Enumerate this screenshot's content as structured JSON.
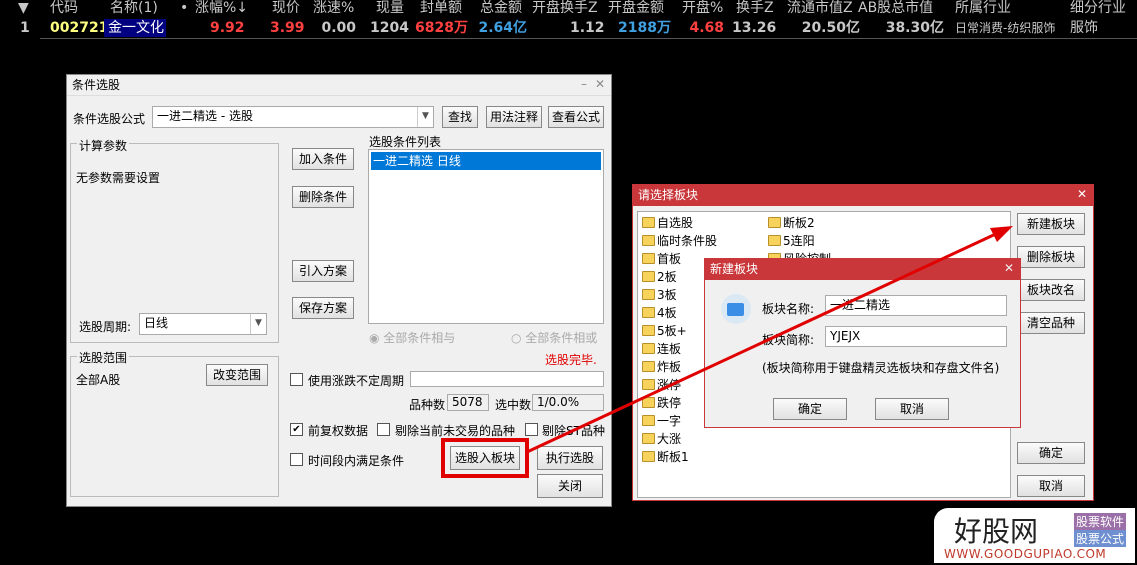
{
  "table": {
    "headers": [
      "▼",
      "代码",
      "名称(1)",
      "•",
      "涨幅%↓",
      "现价",
      "涨速%",
      "现量",
      "封单额",
      "总金额",
      "开盘换手Z",
      "开盘金额",
      "开盘%",
      "换手Z",
      "流通市值Z",
      "AB股总市值",
      "所属行业",
      "细分行业"
    ],
    "row": {
      "index": "1",
      "code": "002721",
      "name": "金一文化",
      "change_pct": "9.92",
      "price": "3.99",
      "speed": "0.00",
      "volume": "1204",
      "seal_amount": "6828万",
      "total_amount": "2.64亿",
      "open_turnover": "1.12",
      "open_amount": "2188万",
      "open_pct": "4.68",
      "turnover": "13.26",
      "float_cap": "20.50亿",
      "total_cap": "38.30亿",
      "industry": "日常消费-纺织服饰",
      "sub_industry": "服饰"
    }
  },
  "screener": {
    "title": "条件选股",
    "formula_label": "条件选股公式",
    "formula_value": "一进二精选  - 选股",
    "find": "查找",
    "usage": "用法注释",
    "view": "查看公式",
    "params_group": "计算参数",
    "no_params": "无参数需要设置",
    "add": "加入条件",
    "delete": "删除条件",
    "import": "引入方案",
    "save": "保存方案",
    "list_label": "选股条件列表",
    "list_items": [
      "一进二精选  日线"
    ],
    "period_label": "选股周期:",
    "period_value": "日线",
    "radio_and": "全部条件相与",
    "radio_or": "全部条件相或",
    "status": "选股完毕.",
    "range_group": "选股范围",
    "range_value": "全部A股",
    "change_range": "改变范围",
    "use_period": "使用涨跌不定周期",
    "count_label": "品种数",
    "count_value": "5078",
    "selected_label": "选中数",
    "selected_value": "1/0.0%",
    "fq": "前复权数据",
    "exclude_untraded": "剔除当前未交易的品种",
    "exclude_st": "剔除ST品种",
    "time_range": "时间段内满足条件",
    "to_block": "选股入板块",
    "execute": "执行选股",
    "close": "关闭"
  },
  "block_dialog": {
    "title": "请选择板块",
    "col1": [
      "自选股",
      "临时条件股",
      "首板",
      "2板",
      "3板",
      "4板",
      "5板+",
      "连板",
      "炸板",
      "涨停",
      "跌停",
      "一字",
      "大涨",
      "断板1"
    ],
    "col2": [
      "断板2",
      "5连阳",
      "风险控制"
    ],
    "new": "新建板块",
    "delete": "删除板块",
    "rename": "板块改名",
    "clear": "清空品种",
    "ok": "确定",
    "cancel": "取消"
  },
  "new_block": {
    "title": "新建板块",
    "name_label": "板块名称:",
    "name_value": "一进二精选",
    "abbr_label": "板块简称:",
    "abbr_value": "YJEJX",
    "hint": "(板块简称用于键盘精灵选板块和存盘文件名)",
    "ok": "确定",
    "cancel": "取消"
  },
  "watermark": {
    "brand": "好股网",
    "tag1": "股票软件",
    "tag2": "股票公式",
    "url": "WWW.GOODGUPIAO.COM"
  },
  "colors": {
    "up": "#ff4040",
    "code": "#ffff80",
    "amount_blue": "#40a0e0",
    "title_red": "#c9373b",
    "highlight": "#e00000"
  }
}
